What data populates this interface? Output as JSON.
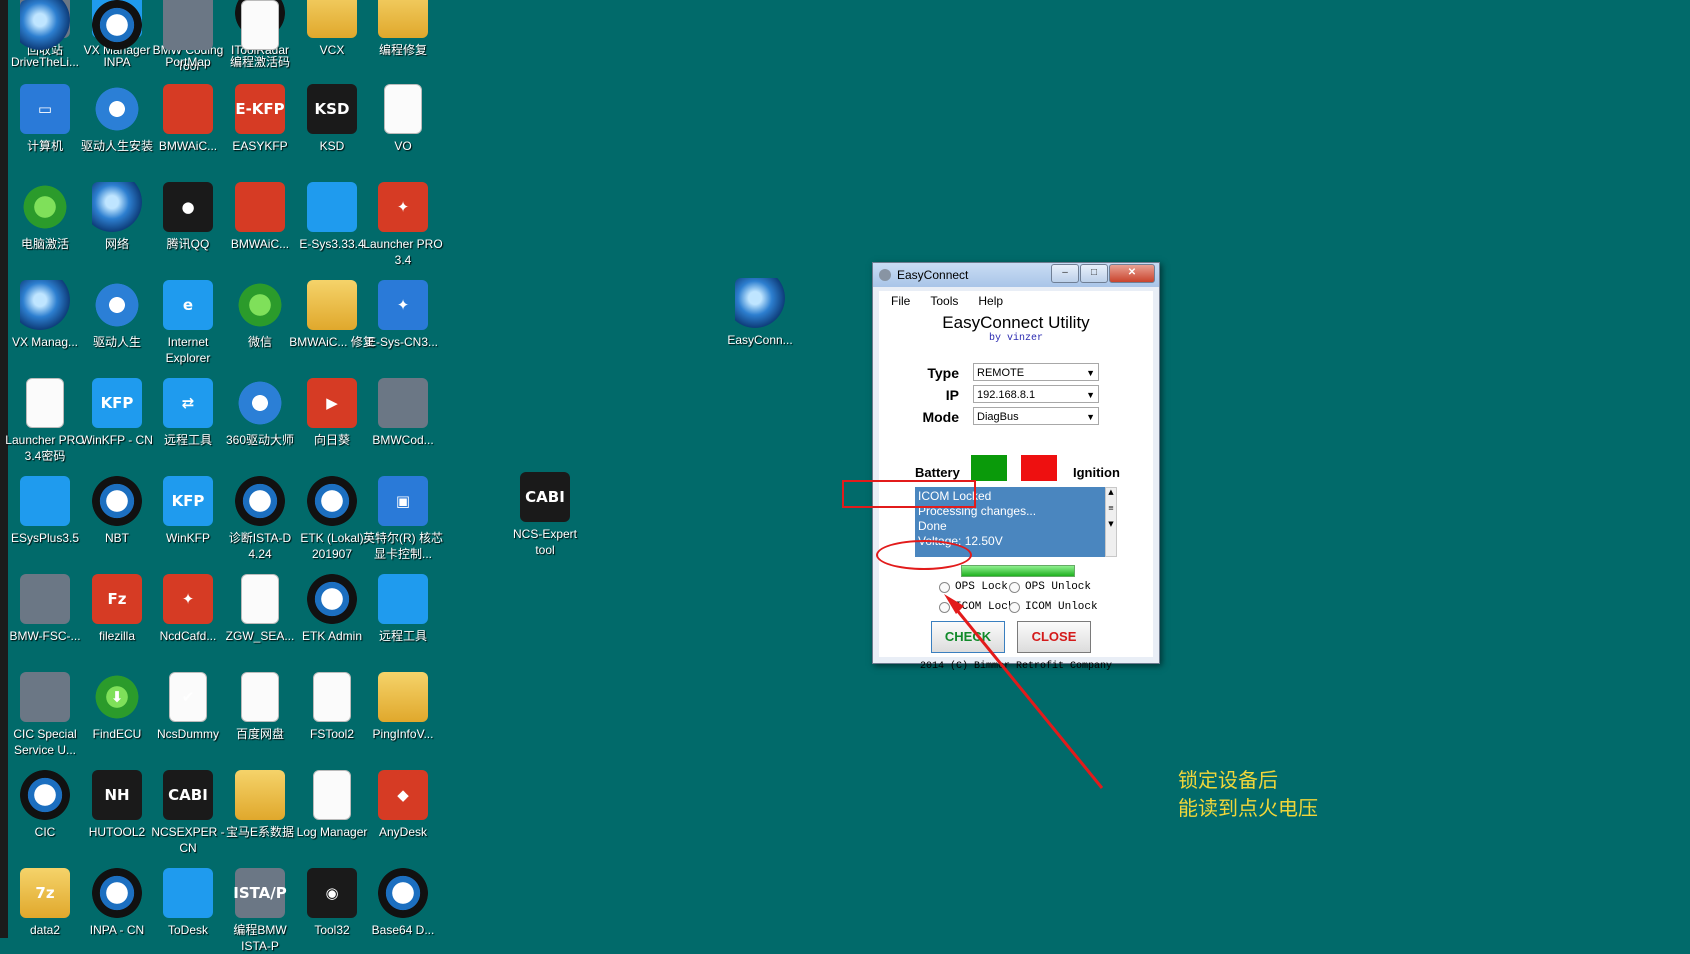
{
  "desktop": {
    "icons": [
      {
        "label": "回收站",
        "icon": "recycle-bin-icon",
        "glyph": "",
        "cls": "g-grey"
      },
      {
        "label": "VX Manager",
        "icon": "vx-manager-icon",
        "glyph": "✕",
        "cls": "g-sky"
      },
      {
        "label": "BMW Coding Tool",
        "icon": "bmw-coding-tool-icon",
        "glyph": "",
        "cls": "g-grey"
      },
      {
        "label": "IToolRadar",
        "icon": "itoolradar-icon",
        "glyph": "",
        "cls": "g-bmw"
      },
      {
        "label": "VCX",
        "icon": "folder-icon",
        "glyph": "",
        "cls": "g-folder"
      },
      {
        "label": "编程修复",
        "icon": "package-icon",
        "glyph": "",
        "cls": "g-folder"
      },
      {
        "label": "计算机",
        "icon": "computer-icon",
        "glyph": "▭",
        "cls": "g-blue"
      },
      {
        "label": "驱动人生安装",
        "icon": "gear-icon",
        "glyph": "",
        "cls": "g-gear"
      },
      {
        "label": "BMWAiC...",
        "icon": "bmwaic-icon",
        "glyph": "",
        "cls": "g-red"
      },
      {
        "label": "EASYKFP",
        "icon": "easykfp-icon",
        "glyph": "E-KFP",
        "cls": "g-red"
      },
      {
        "label": "KSD",
        "icon": "ksd-disc-icon",
        "glyph": "KSD",
        "cls": "g-dark"
      },
      {
        "label": "VO",
        "icon": "vo-icon",
        "glyph": "",
        "cls": "g-doc"
      },
      {
        "label": "电脑激活",
        "icon": "windows-orb-icon",
        "glyph": "",
        "cls": "g-green"
      },
      {
        "label": "网络",
        "icon": "network-icon",
        "glyph": "",
        "cls": "g-globe"
      },
      {
        "label": "腾讯QQ",
        "icon": "qq-penguin-icon",
        "glyph": "●",
        "cls": "g-dark"
      },
      {
        "label": "BMWAiC...",
        "icon": "bmwaic-icon",
        "glyph": "",
        "cls": "g-red"
      },
      {
        "label": "E-Sys3.33.4",
        "icon": "esys-icon",
        "glyph": "",
        "cls": "g-sky"
      },
      {
        "label": "Launcher PRO 3.4",
        "icon": "launcher-icon",
        "glyph": "✦",
        "cls": "g-red"
      },
      {
        "label": "VX Manag...",
        "icon": "vx-globe-icon",
        "glyph": "",
        "cls": "g-globe"
      },
      {
        "label": "驱动人生",
        "icon": "gear-icon",
        "glyph": "",
        "cls": "g-gear"
      },
      {
        "label": "Internet Explorer",
        "icon": "internet-explorer-icon",
        "glyph": "e",
        "cls": "g-sky"
      },
      {
        "label": "微信",
        "icon": "wechat-icon",
        "glyph": "",
        "cls": "g-green"
      },
      {
        "label": "BMWAiC... 修复",
        "icon": "package-icon",
        "glyph": "",
        "cls": "g-folder"
      },
      {
        "label": "E-Sys-CN3...",
        "icon": "esys-cn-icon",
        "glyph": "✦",
        "cls": "g-blue"
      },
      {
        "label": "Launcher PRO 3.4密码",
        "icon": "document-icon",
        "glyph": "",
        "cls": "g-doc"
      },
      {
        "label": "WinKFP - CN",
        "icon": "winkfp-icon",
        "glyph": "KFP",
        "cls": "g-sky"
      },
      {
        "label": "远程工具",
        "icon": "teamviewer-icon",
        "glyph": "⇄",
        "cls": "g-sky"
      },
      {
        "label": "360驱动大师",
        "icon": "driver-master-icon",
        "glyph": "",
        "cls": "g-gear"
      },
      {
        "label": "向日葵",
        "icon": "sunflower-icon",
        "glyph": "▶",
        "cls": "g-red"
      },
      {
        "label": "BMWCod...",
        "icon": "bmwcod-icon",
        "glyph": "",
        "cls": "g-grey"
      },
      {
        "label": "ESysPlus3.5",
        "icon": "esysplus-icon",
        "glyph": "",
        "cls": "g-sky"
      },
      {
        "label": "NBT",
        "icon": "bmw-logo-icon",
        "glyph": "",
        "cls": "g-bmw"
      },
      {
        "label": "WinKFP",
        "icon": "winkfp-icon",
        "glyph": "KFP",
        "cls": "g-sky"
      },
      {
        "label": "诊断ISTA-D 4.24",
        "icon": "bmw-logo-icon",
        "glyph": "",
        "cls": "g-bmw"
      },
      {
        "label": "ETK (Lokal) 201907",
        "icon": "bmw-logo-icon",
        "glyph": "",
        "cls": "g-bmw"
      },
      {
        "label": "英特尔(R) 核芯显卡控制...",
        "icon": "intel-graphics-icon",
        "glyph": "▣",
        "cls": "g-blue"
      },
      {
        "label": "BMW-FSC-...",
        "icon": "disc-icon",
        "glyph": "",
        "cls": "g-grey"
      },
      {
        "label": "filezilla",
        "icon": "filezilla-icon",
        "glyph": "Fz",
        "cls": "g-red"
      },
      {
        "label": "NcdCafd...",
        "icon": "ncdcafd-icon",
        "glyph": "✦",
        "cls": "g-red"
      },
      {
        "label": "ZGW_SEA...",
        "icon": "binoculars-icon",
        "glyph": "",
        "cls": "g-doc"
      },
      {
        "label": "ETK Admin",
        "icon": "bmw-logo-icon",
        "glyph": "",
        "cls": "g-bmw"
      },
      {
        "label": "远程工具",
        "icon": "todesk-icon",
        "glyph": "",
        "cls": "g-sky"
      },
      {
        "label": "CIC Special Service U...",
        "icon": "tools-icon",
        "glyph": "",
        "cls": "g-grey"
      },
      {
        "label": "FindECU",
        "icon": "download-icon",
        "glyph": "⬇",
        "cls": "g-green"
      },
      {
        "label": "NcsDummy",
        "icon": "checkbox-icon",
        "glyph": "✔",
        "cls": "g-doc"
      },
      {
        "label": "百度网盘",
        "icon": "baidu-netdisk-icon",
        "glyph": "",
        "cls": "g-doc"
      },
      {
        "label": "FSTool2",
        "icon": "fstool-icon",
        "glyph": "",
        "cls": "g-doc"
      },
      {
        "label": "PingInfoV...",
        "icon": "folder-icon",
        "glyph": "",
        "cls": "g-folder"
      },
      {
        "label": "CIC",
        "icon": "bmw-logo-icon",
        "glyph": "",
        "cls": "g-bmw"
      },
      {
        "label": "HUTOOL2",
        "icon": "hutool-icon",
        "glyph": "NH",
        "cls": "g-dark"
      },
      {
        "label": "NCSEXPER - CN",
        "icon": "ncsexpert-icon",
        "glyph": "CABI",
        "cls": "g-dark"
      },
      {
        "label": "宝马E系数据",
        "icon": "folder-icon",
        "glyph": "",
        "cls": "g-folder"
      },
      {
        "label": "Log Manager",
        "icon": "log-manager-icon",
        "glyph": "",
        "cls": "g-doc"
      },
      {
        "label": "AnyDesk",
        "icon": "anydesk-icon",
        "glyph": "◆",
        "cls": "g-red"
      },
      {
        "label": "data2",
        "icon": "7zip-icon",
        "glyph": "7z",
        "cls": "g-folder"
      },
      {
        "label": "INPA - CN",
        "icon": "bmw-logo-icon",
        "glyph": "",
        "cls": "g-bmw"
      },
      {
        "label": "ToDesk",
        "icon": "todesk-icon",
        "glyph": "",
        "cls": "g-sky"
      },
      {
        "label": "编程BMW ISTA-P",
        "icon": "ista-p-icon",
        "glyph": "ISTA/P",
        "cls": "g-grey"
      },
      {
        "label": "Tool32",
        "icon": "eye-icon",
        "glyph": "◉",
        "cls": "g-dark"
      },
      {
        "label": "Base64 D...",
        "icon": "bmw-logo-icon",
        "glyph": "",
        "cls": "g-bmw"
      },
      {
        "label": "DriveTheLi...",
        "icon": "drive-icon",
        "glyph": "",
        "cls": "g-globe"
      },
      {
        "label": "INPA",
        "icon": "bmw-logo-icon",
        "glyph": "",
        "cls": "g-bmw"
      },
      {
        "label": "PortMap",
        "icon": "network-computers-icon",
        "glyph": "",
        "cls": "g-grey"
      },
      {
        "label": "编程激活码",
        "icon": "document-icon",
        "glyph": "",
        "cls": "g-doc"
      }
    ],
    "extra_icons": [
      {
        "label": "NCS-Expert tool",
        "icon": "ncsexpert-icon",
        "glyph": "CABI",
        "cls": "g-dark"
      },
      {
        "label": "EasyConn...",
        "icon": "easyconnect-globe-icon",
        "glyph": "",
        "cls": "g-globe"
      }
    ]
  },
  "window": {
    "title": "EasyConnect",
    "menu": [
      "File",
      "Tools",
      "Help"
    ],
    "heading": "EasyConnect Utility",
    "byline": "by vinzer",
    "fields": {
      "type_label": "Type",
      "type_value": "REMOTE",
      "ip_label": "IP",
      "ip_value": "192.168.8.1",
      "mode_label": "Mode",
      "mode_value": "DiagBus"
    },
    "battery_label": "Battery",
    "ignition_label": "Ignition",
    "battery_color": "#0a9a0a",
    "ignition_color": "#ee1010",
    "status_lines": [
      "ICOM Locked",
      "Processing changes...",
      "Done",
      "Voltage: 12.50V"
    ],
    "progress": 1.0,
    "radios": {
      "ops_lock": "OPS Lock",
      "ops_unlock": "OPS Unlock",
      "icom_lock": "ICOM Lock",
      "icom_unlock": "ICOM Unlock"
    },
    "check_label": "CHECK",
    "close_label": "CLOSE",
    "copyright": "2014 (C) Bimmer Retrofit Company",
    "min_glyph": "‒",
    "max_glyph": "□",
    "close_glyph": "✕"
  },
  "annotation": {
    "lines": [
      "锁定设备后",
      "能读到点火电压"
    ],
    "color": "#e21b1b",
    "text_color": "#f0d63a"
  }
}
